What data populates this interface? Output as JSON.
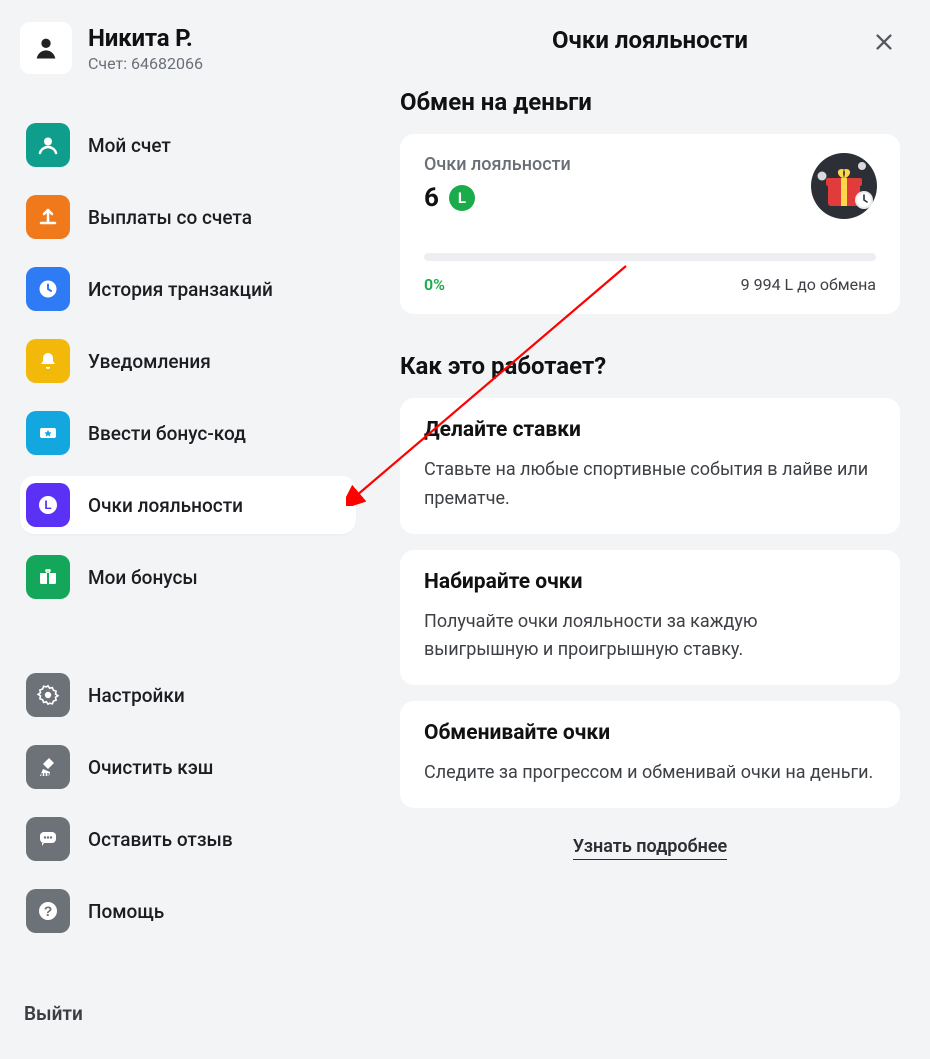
{
  "profile": {
    "name": "Никита Р.",
    "account_label": "Счет: 64682066"
  },
  "sidebar": {
    "items": [
      {
        "label": "Мой счет",
        "icon": "account",
        "color": "#0f9e8b",
        "active": false
      },
      {
        "label": "Выплаты со счета",
        "icon": "upload",
        "color": "#f07a1b",
        "active": false
      },
      {
        "label": "История транзакций",
        "icon": "clock",
        "color": "#2f7af5",
        "active": false
      },
      {
        "label": "Уведомления",
        "icon": "bell",
        "color": "#f2b90a",
        "active": false
      },
      {
        "label": "Ввести бонус-код",
        "icon": "ticket",
        "color": "#13a7e0",
        "active": false
      },
      {
        "label": "Очки лояльности",
        "icon": "loyalty-badge",
        "color": "#5a31f5",
        "active": true
      },
      {
        "label": "Мои бонусы",
        "icon": "gift",
        "color": "#14a75c",
        "active": false
      }
    ],
    "secondary": [
      {
        "label": "Настройки",
        "icon": "gear",
        "color": "#6d7178"
      },
      {
        "label": "Очистить кэш",
        "icon": "broom",
        "color": "#6d7178"
      },
      {
        "label": "Оставить отзыв",
        "icon": "comment",
        "color": "#6d7178"
      },
      {
        "label": "Помощь",
        "icon": "help",
        "color": "#6d7178"
      }
    ],
    "logout_label": "Выйти"
  },
  "header": {
    "title": "Очки лояльности"
  },
  "exchange": {
    "section_title": "Обмен на деньги",
    "points_label": "Очки лояльности",
    "points_value": "6",
    "l_symbol": "L",
    "progress_percent": "0%",
    "progress_remaining": "9 994 L до обмена"
  },
  "how": {
    "section_title": "Как это работает?",
    "cards": [
      {
        "title": "Делайте ставки",
        "text": "Ставьте на любые спортивные события в лайве или прематче."
      },
      {
        "title": "Набирайте очки",
        "text": "Получайте очки лояльности за каждую выигрышную и проигрышную ставку."
      },
      {
        "title": "Обменивайте очки",
        "text": "Следите за прогрессом и обменивай очки на деньги."
      }
    ],
    "learn_more": "Узнать подробнее"
  },
  "icon_svgs": {
    "account": "<circle cx='12' cy='8.5' r='4' fill='white'/><path d='M4 20c1-4 5-6 8-6s7 2 8 6' fill='none' stroke='white' stroke-width='2.5' stroke-linecap='round'/>",
    "upload": "<path d='M12 16V5M12 5l-4 4M12 5l4 4' stroke='white' stroke-width='2.5' fill='none' stroke-linecap='round' stroke-linejoin='round'/><path d='M5 18h14' stroke='white' stroke-width='2.5' stroke-linecap='round'/>",
    "clock": "<circle cx='12' cy='12' r='8.5' fill='white'/><path d='M12 7.5V12l3 2' stroke='#2f7af5' stroke-width='2' fill='none' stroke-linecap='round'/>",
    "bell": "<path d='M12 4a5 5 0 0 0-5 5v3l-2 3h14l-2-3V9a5 5 0 0 0-5-5z' fill='white'/><path d='M10 18a2 2 0 0 0 4 0' fill='white'/>",
    "ticket": "<rect x='4' y='7' width='16' height='10' rx='2' fill='white'/><polygon points='12,9 13.2,11.3 15.7,11.5 13.8,13.1 14.4,15.6 12,14.2 9.6,15.6 10.2,13.1 8.3,11.5 10.8,11.3' fill='#13a7e0'/>",
    "loyalty-badge": "<circle cx='12' cy='12' r='9' fill='white'/><text x='12' y='16' text-anchor='middle' font-family='Arial' font-size='12' font-weight='700' fill='#5a31f5'>L</text>",
    "gift": "<rect x='4' y='10' width='16' height='9' rx='1.5' fill='white'/><rect x='4' y='8' width='16' height='3' fill='white'/><rect x='11' y='8' width='2' height='11' fill='#14a75c'/><path d='M12 8c-3 0-4-4-1-4 2 0 1 4 1 4zm0 0c3 0 4-4 1-4-2 0-1 4-1 4z' fill='white'/>",
    "gear": "<circle cx='12' cy='12' r='3.2' fill='white'/><path d='M12 2.8l1.6 2.4 2.8-.6 1 2.7 2.7 1-.6 2.8 2.4 1.6-2.4 1.6.6 2.8-2.7 1-1 2.7-2.8-.6L12 21.2l-1.6-2.4-2.8.6-1-2.7-2.7-1 .6-2.8L2.1 11.4l2.4-1.6-.6-2.8 2.7-1 1-2.7 2.8.6L12 2.8z' fill='none' stroke='white' stroke-width='1.6'/>",
    "broom": "<path d='M13 3l5 5-6 6-5-5 6-6z' fill='white'/><path d='M7 14l-3 7h9l1-4' fill='white'/><path d='M6 18v3M9 18v3M12 18v3' stroke='#6d7178' stroke-width='1.4'/>",
    "comment": "<rect x='4' y='5' width='16' height='11' rx='4' fill='white'/><path d='M8 16l-2 3v-3' fill='white'/><circle cx='9' cy='10.5' r='1.2' fill='#6d7178'/><circle cx='12' cy='10.5' r='1.2' fill='#6d7178'/><circle cx='15' cy='10.5' r='1.2' fill='#6d7178'/>",
    "help": "<circle cx='12' cy='12' r='9' fill='white'/><text x='12' y='17' text-anchor='middle' font-family='Arial' font-size='14' font-weight='700' fill='#6d7178'>?</text>"
  }
}
